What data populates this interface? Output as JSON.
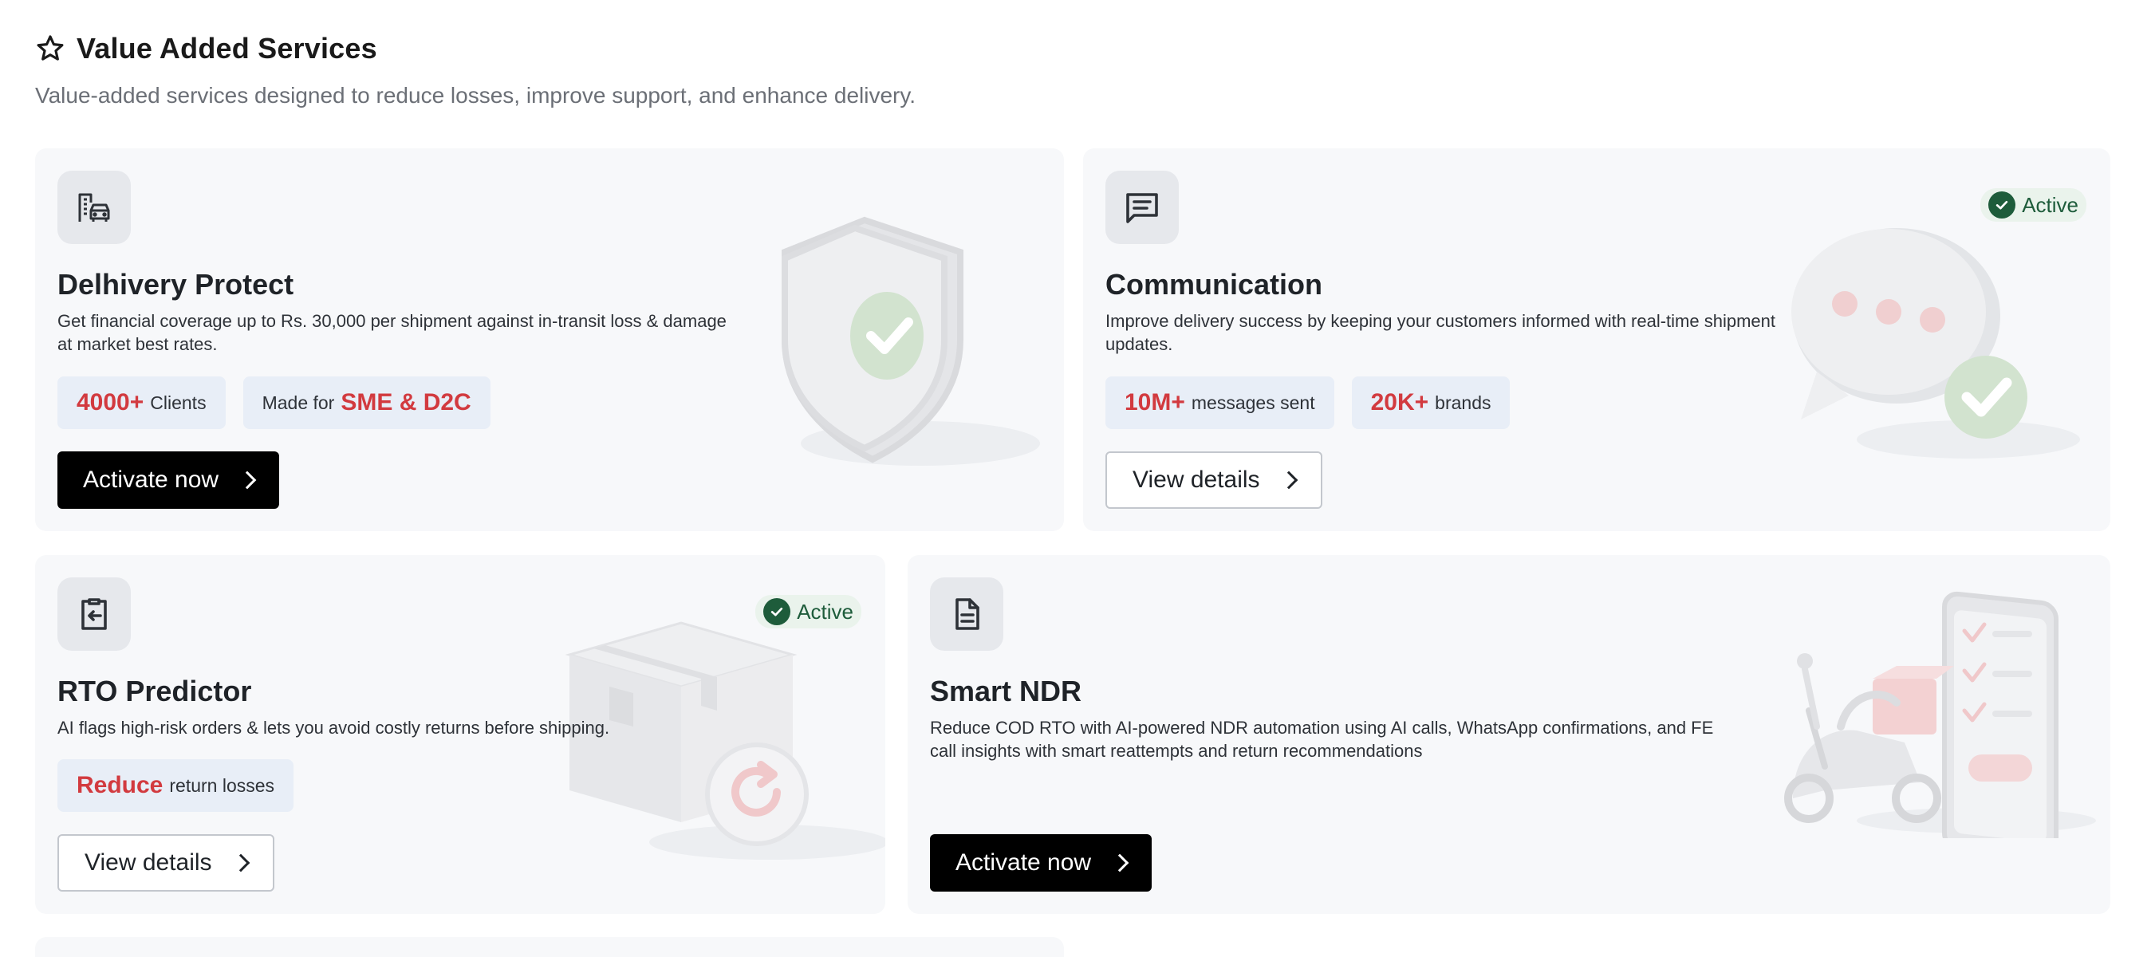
{
  "header": {
    "title": "Value Added Services",
    "subtitle": "Value-added services designed to reduce losses, improve support, and enhance delivery.",
    "icon": "star-outline-icon"
  },
  "cards": [
    {
      "title": "Delhivery Protect",
      "description": "Get financial coverage up to Rs. 30,000 per shipment against in-transit loss & damage at market best rates.",
      "icon": "building-car-icon",
      "stats": [
        {
          "highlight": "4000+",
          "text": "Clients"
        },
        {
          "prefix": "Made for",
          "highlight": "SME & D2C"
        }
      ],
      "button": "Activate now"
    },
    {
      "title": "Communication",
      "description": "Improve delivery success by keeping your customers informed with real-time shipment updates.",
      "icon": "chat-message-icon",
      "badge": "Active",
      "stats": [
        {
          "highlight": "10M+",
          "text": "messages sent"
        },
        {
          "highlight": "20K+",
          "text": "brands"
        }
      ],
      "button": "View details"
    },
    {
      "title": "RTO Predictor",
      "description": "AI flags high-risk orders & lets you avoid costly returns before shipping.",
      "icon": "clipboard-return-icon",
      "badge": "Active",
      "stats": [
        {
          "highlight": "Reduce",
          "text": "return losses"
        }
      ],
      "button": "View details"
    },
    {
      "title": "Smart NDR",
      "description": "Reduce COD RTO with AI-powered NDR automation using AI calls, WhatsApp confirmations, and FE call insights with smart reattempts and return recommendations",
      "icon": "document-icon",
      "button": "Activate now"
    }
  ],
  "colors": {
    "highlight": "#d23a3f",
    "badge_green": "#1e5c3b",
    "card_bg": "#f7f8fa",
    "stat_bg": "#e8eef7",
    "dark_button": "#000000"
  }
}
